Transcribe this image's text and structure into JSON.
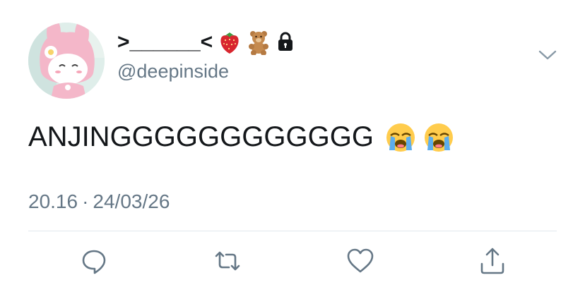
{
  "user": {
    "display_name": ">______<",
    "handle": "@deepinside",
    "name_emojis": [
      "strawberry-emoji",
      "teddy-bear-emoji",
      "lock-emoji"
    ]
  },
  "tweet": {
    "text": "ANJINGGGGGGGGGGGG",
    "trailing_emojis": [
      "loudly-crying-face-emoji",
      "loudly-crying-face-emoji"
    ],
    "time": "20.16",
    "separator": "·",
    "date": "24/03/26"
  },
  "actions": [
    "reply-icon",
    "retweet-icon",
    "like-icon",
    "share-icon"
  ],
  "colors": {
    "text": "#14171a",
    "secondary": "#657786",
    "divider": "#e1e8ed",
    "avatar_bg": "#dfeeea"
  }
}
